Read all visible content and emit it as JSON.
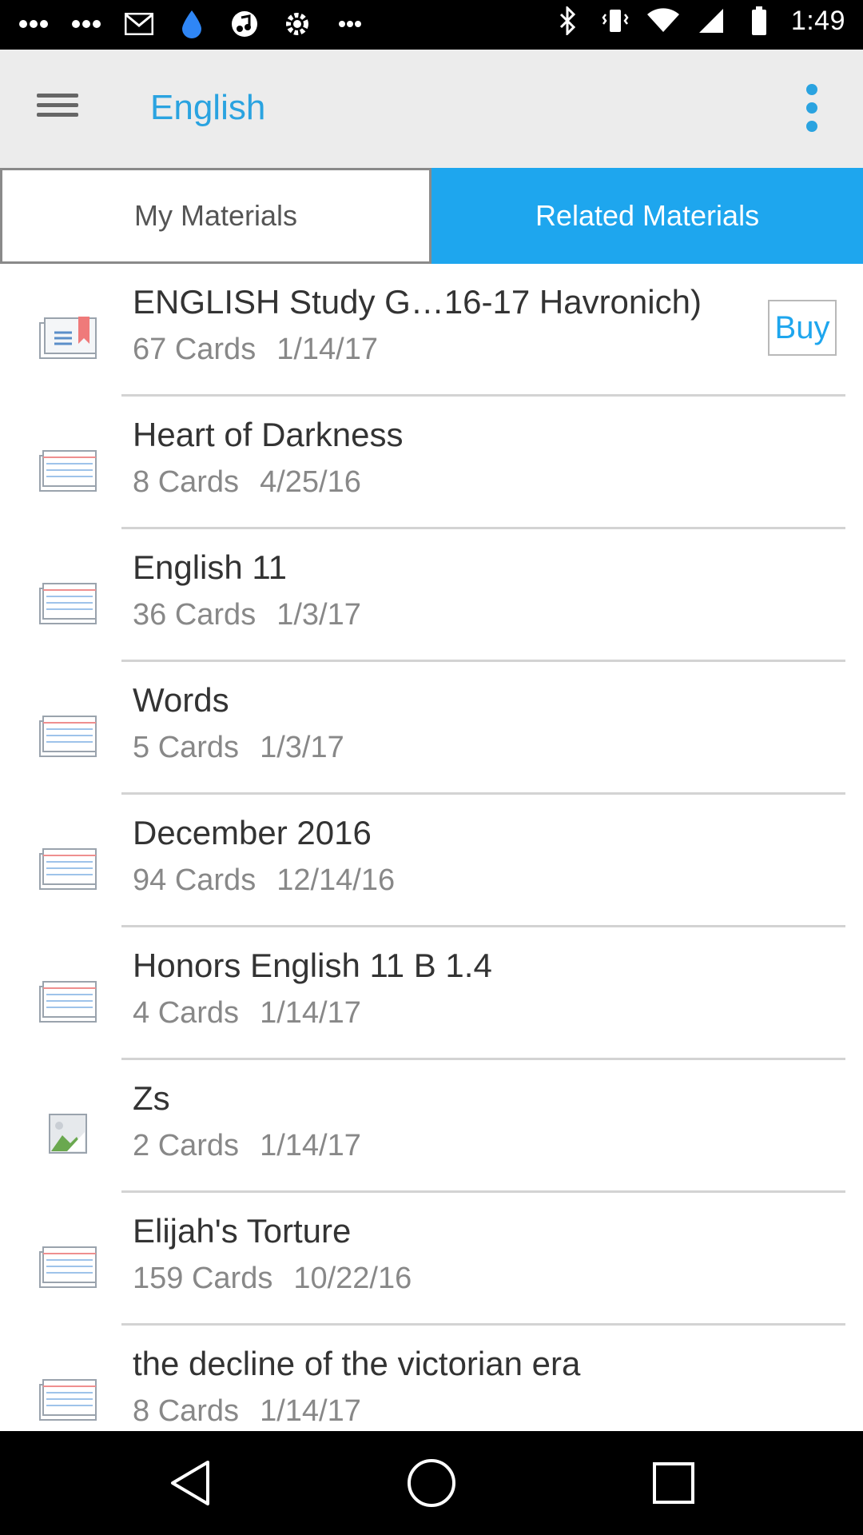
{
  "status_bar": {
    "time": "1:49",
    "left_icons": [
      "notification-dots-icon",
      "notification-dots-icon",
      "email-icon",
      "water-drop-icon",
      "music-icon",
      "gear-icon",
      "more-dots-icon"
    ],
    "right_icons": [
      "bluetooth-icon",
      "vibrate-icon",
      "wifi-icon",
      "signal-icon",
      "battery-icon"
    ]
  },
  "app_bar": {
    "title": "English",
    "accent_color": "#2aa3e0"
  },
  "tabs": [
    {
      "label": "My Materials",
      "selected": false
    },
    {
      "label": "Related Materials",
      "selected": true
    }
  ],
  "list": {
    "items": [
      {
        "title": "ENGLISH Study G…16-17 Havronich)",
        "cards": "67 Cards",
        "date": "1/14/17",
        "buy_label": "Buy",
        "icon": "bookmark-card-icon"
      },
      {
        "title": "Heart of Darkness",
        "cards": "8 Cards",
        "date": "4/25/16",
        "icon": "card-set-icon"
      },
      {
        "title": "English 11",
        "cards": "36 Cards",
        "date": "1/3/17",
        "icon": "card-set-icon"
      },
      {
        "title": "Words",
        "cards": "5 Cards",
        "date": "1/3/17",
        "icon": "card-set-icon"
      },
      {
        "title": "December 2016",
        "cards": "94 Cards",
        "date": "12/14/16",
        "icon": "card-set-icon"
      },
      {
        "title": "Honors English 11 B 1.4",
        "cards": "4 Cards",
        "date": "1/14/17",
        "icon": "card-set-icon"
      },
      {
        "title": "Zs",
        "cards": "2 Cards",
        "date": "1/14/17",
        "icon": "broken-image-icon"
      },
      {
        "title": "Elijah's Torture",
        "cards": "159 Cards",
        "date": "10/22/16",
        "icon": "card-set-icon"
      },
      {
        "title": "the decline of the victorian era",
        "cards": "8 Cards",
        "date": "1/14/17",
        "icon": "card-set-icon"
      }
    ]
  },
  "nav_bar": {
    "buttons": [
      "back-icon",
      "home-icon",
      "recents-icon"
    ]
  }
}
